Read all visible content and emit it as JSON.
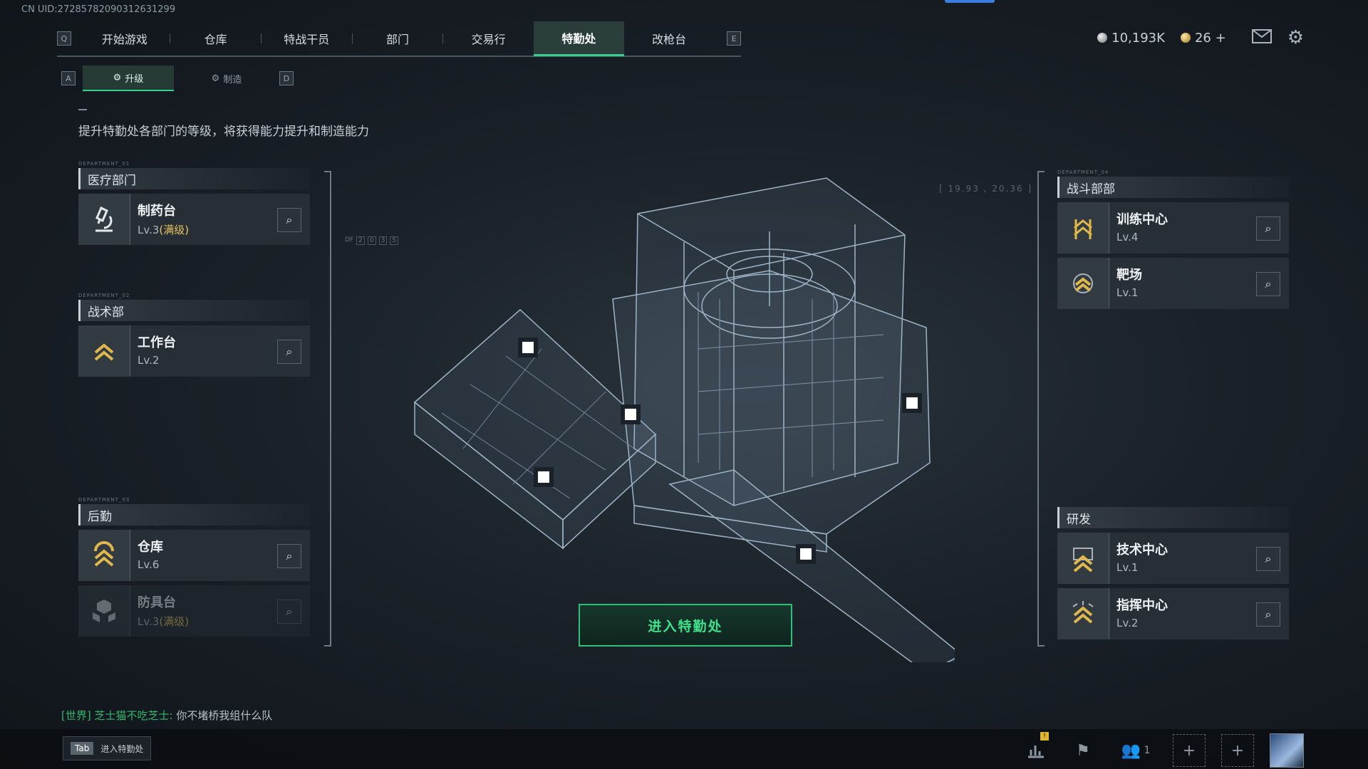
{
  "uid": "CN UID:27285782090312631299",
  "nav": {
    "left_key": "Q",
    "right_key": "E",
    "tabs": [
      "开始游戏",
      "仓库",
      "特战干员",
      "部门",
      "交易行",
      "特勤处",
      "改枪台"
    ],
    "active": "特勤处"
  },
  "currency": {
    "silver": "10,193K",
    "gold": "26"
  },
  "subtabs": {
    "left_key": "A",
    "right_key": "D",
    "items": [
      "升级",
      "制造"
    ],
    "active": "升级"
  },
  "description": "提升特勤处各部门的等级，将获得能力提升和制造能力",
  "departments": {
    "medical": {
      "tag": "DEPARTMENT_01",
      "title": "医疗部门",
      "items": [
        {
          "name": "制药台",
          "level": "Lv.3",
          "max": "(满级)"
        }
      ]
    },
    "tactical": {
      "tag": "DEPARTMENT_02",
      "title": "战术部",
      "items": [
        {
          "name": "工作台",
          "level": "Lv.2"
        }
      ]
    },
    "logistics": {
      "tag": "DEPARTMENT_03",
      "title": "后勤",
      "items": [
        {
          "name": "仓库",
          "level": "Lv.6"
        },
        {
          "name": "防具台",
          "level": "Lv.3",
          "max": "(满级)"
        }
      ]
    },
    "combat": {
      "tag": "DEPARTMENT_04",
      "title": "战斗部部",
      "items": [
        {
          "name": "训练中心",
          "level": "Lv.4"
        },
        {
          "name": "靶场",
          "level": "Lv.1"
        }
      ]
    },
    "research": {
      "title": "研发",
      "items": [
        {
          "name": "技术中心",
          "level": "Lv.1"
        },
        {
          "name": "指挥中心",
          "level": "Lv.2"
        }
      ]
    }
  },
  "coords_text": "[ 19.93 , 20.36 ]",
  "df_label": "DF",
  "df_cells": [
    "2",
    "0",
    "3",
    "5"
  ],
  "enter_button": "进入特勤处",
  "chat": {
    "channel": "[世界]",
    "sender": "芝士猫不吃芝士:",
    "message": "你不堵桥我组什么队"
  },
  "tab_hint": {
    "key": "Tab",
    "label": "进入特勤处"
  },
  "social_count": "1",
  "accent_color": "#35d08a",
  "icons": [
    "silver-coin-icon",
    "gold-coin-icon",
    "mail-icon",
    "gear-icon",
    "search-icon",
    "microscope-icon",
    "chevron-rank-icon",
    "stats-icon",
    "flag-icon",
    "friends-icon",
    "plus-icon"
  ]
}
